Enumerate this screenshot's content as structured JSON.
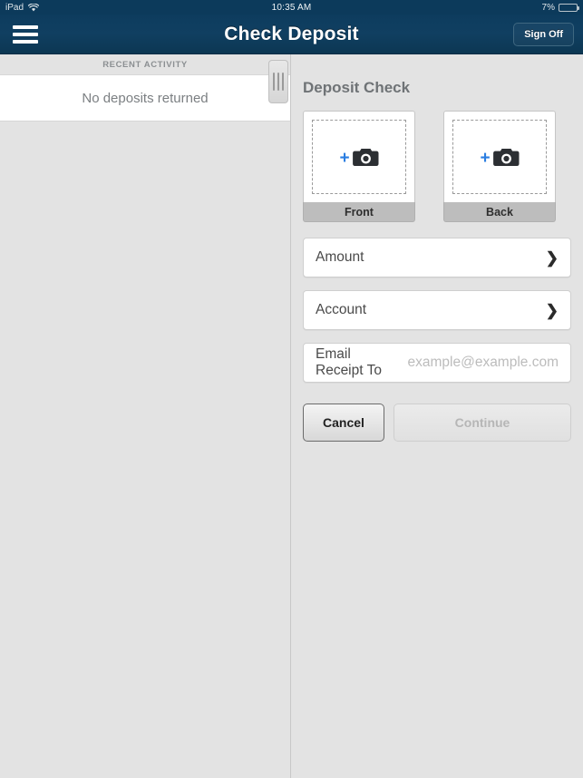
{
  "status_bar": {
    "device": "iPad",
    "wifi_icon": "wifi-icon",
    "time": "10:35 AM",
    "battery_percent": "7%",
    "battery_level": 7
  },
  "nav_bar": {
    "menu_icon": "hamburger-menu-icon",
    "title": "Check Deposit",
    "sign_off_label": "Sign Off"
  },
  "master_panel": {
    "section_header": "RECENT ACTIVITY",
    "empty_message": "No deposits returned"
  },
  "detail_panel": {
    "title": "Deposit Check",
    "captures": [
      {
        "label": "Front",
        "icon": "camera-add-icon",
        "plus": "+"
      },
      {
        "label": "Back",
        "icon": "camera-add-icon",
        "plus": "+"
      }
    ],
    "fields": [
      {
        "label": "Amount",
        "chevron": "❯",
        "placeholder": ""
      },
      {
        "label": "Account",
        "chevron": "❯",
        "placeholder": ""
      },
      {
        "label": "Email Receipt To",
        "chevron": "",
        "placeholder": "example@example.com"
      }
    ],
    "buttons": {
      "cancel": "Cancel",
      "continue": "Continue"
    },
    "splitter_icon": "drag-handle-icon"
  },
  "colors": {
    "nav_blue": "#0d3c5e",
    "accent_blue": "#2a7de1",
    "page_gray": "#e3e3e3",
    "battery_red": "#e0342e"
  }
}
